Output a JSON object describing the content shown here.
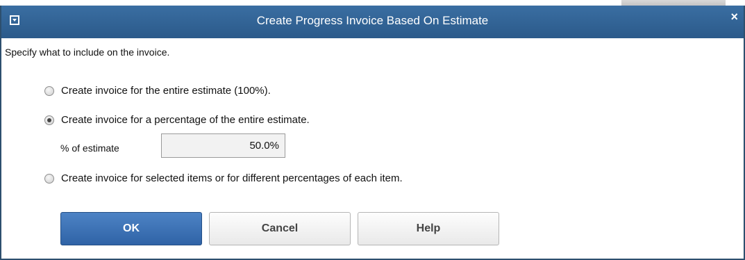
{
  "dialog": {
    "title": "Create Progress Invoice Based On Estimate",
    "close_label": "×",
    "instruction": "Specify what to include on the invoice."
  },
  "options": [
    {
      "label": "Create invoice for the entire estimate (100%).",
      "checked": false
    },
    {
      "label": "Create invoice for a percentage of the entire estimate.",
      "checked": true
    },
    {
      "label": "Create invoice for selected items or for different percentages of each item.",
      "checked": false
    }
  ],
  "percent": {
    "label": "% of estimate",
    "value": "50.0%"
  },
  "buttons": {
    "ok": "OK",
    "cancel": "Cancel",
    "help": "Help"
  },
  "colors": {
    "titlebar": "#2f6193",
    "ok_button": "#3a6fb3"
  }
}
